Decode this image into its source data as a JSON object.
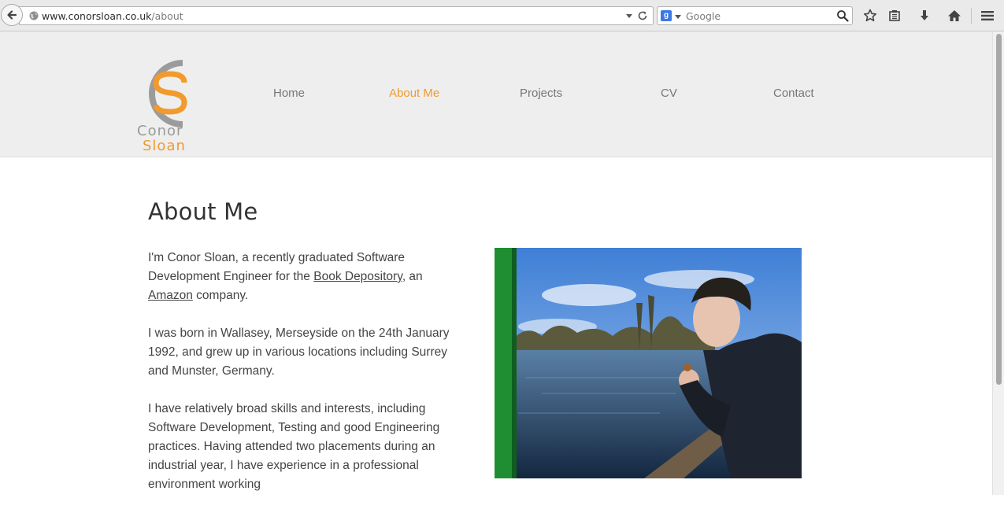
{
  "browser": {
    "url_host": "www.conorsloan.co.uk",
    "url_path": "/about",
    "search_placeholder": "Google",
    "search_engine_icon": "g-icon"
  },
  "logo": {
    "line1": "Conor",
    "line2": "Sloan"
  },
  "nav": {
    "items": [
      {
        "label": "Home"
      },
      {
        "label": "About Me",
        "active": true
      },
      {
        "label": "Projects"
      },
      {
        "label": "CV"
      },
      {
        "label": "Contact"
      }
    ]
  },
  "main": {
    "title": "About Me",
    "p1_before": "I'm Conor Sloan, a recently graduated Software Development Engineer for the ",
    "p1_link1": "Book Depository",
    "p1_mid": ", an ",
    "p1_link2": "Amazon",
    "p1_after": " company.",
    "p2": "I was born in Wallasey, Merseyside on the 24th January 1992, and grew up in various locations including Surrey and Munster, Germany.",
    "p3": "I have relatively broad skills and interests, including Software Development, Testing and good Engineering practices. Having attended two placements during an industrial year, I have experience in a professional environment working"
  },
  "colors": {
    "accent": "#f29a2e",
    "nav_text": "#777777",
    "logo_grey": "#9b9b9b",
    "header_bg": "#eeeeee"
  }
}
